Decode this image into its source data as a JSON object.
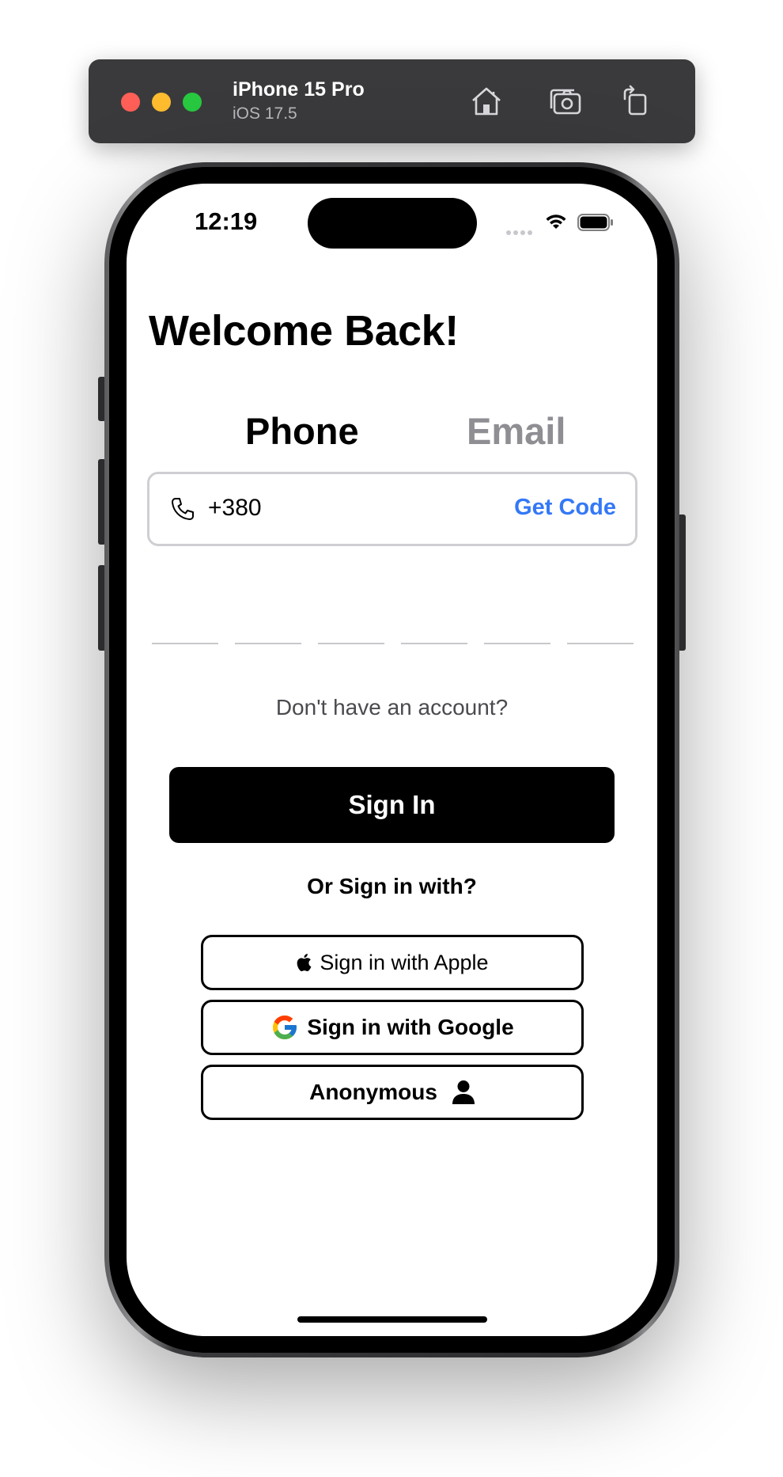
{
  "simulator": {
    "device_name": "iPhone 15 Pro",
    "os_version": "iOS 17.5",
    "icons": [
      "home-icon",
      "screenshot-icon",
      "rotate-icon"
    ]
  },
  "status_bar": {
    "time": "12:19",
    "icons": [
      "cellular-dots-icon",
      "wifi-icon",
      "battery-icon"
    ]
  },
  "page": {
    "title": "Welcome Back!"
  },
  "tabs": [
    {
      "label": "Phone",
      "selected": true
    },
    {
      "label": "Email",
      "selected": false
    }
  ],
  "phone_field": {
    "icon": "phone-icon",
    "value": "+380",
    "action_label": "Get Code"
  },
  "otp": {
    "slots": 6
  },
  "no_account_text": "Don't have an account?",
  "sign_in_button": "Sign In",
  "or_sign_in_text": "Or Sign in with?",
  "social_buttons": {
    "apple": {
      "label": "Sign in with Apple",
      "icon": "apple-logo-icon"
    },
    "google": {
      "label": "Sign in with Google",
      "icon": "google-logo-icon"
    },
    "anonymous": {
      "label": "Anonymous",
      "icon": "person-icon"
    }
  },
  "colors": {
    "accent": "#3478f6",
    "tab_inactive": "#8e8e93",
    "primary_button": "#000000"
  }
}
